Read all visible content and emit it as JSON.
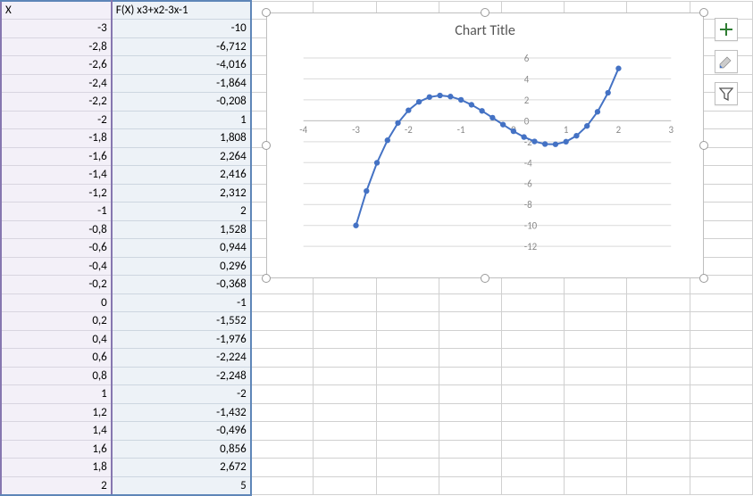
{
  "columns": {
    "a_header": "X",
    "b_header": "F(X) x3+x2-3x-1"
  },
  "rows": [
    {
      "x": "-3",
      "fx": "-10"
    },
    {
      "x": "-2,8",
      "fx": "-6,712"
    },
    {
      "x": "-2,6",
      "fx": "-4,016"
    },
    {
      "x": "-2,4",
      "fx": "-1,864"
    },
    {
      "x": "-2,2",
      "fx": "-0,208"
    },
    {
      "x": "-2",
      "fx": "1"
    },
    {
      "x": "-1,8",
      "fx": "1,808"
    },
    {
      "x": "-1,6",
      "fx": "2,264"
    },
    {
      "x": "-1,4",
      "fx": "2,416"
    },
    {
      "x": "-1,2",
      "fx": "2,312"
    },
    {
      "x": "-1",
      "fx": "2"
    },
    {
      "x": "-0,8",
      "fx": "1,528"
    },
    {
      "x": "-0,6",
      "fx": "0,944"
    },
    {
      "x": "-0,4",
      "fx": "0,296"
    },
    {
      "x": "-0,2",
      "fx": "-0,368"
    },
    {
      "x": "0",
      "fx": "-1"
    },
    {
      "x": "0,2",
      "fx": "-1,552"
    },
    {
      "x": "0,4",
      "fx": "-1,976"
    },
    {
      "x": "0,6",
      "fx": "-2,224"
    },
    {
      "x": "0,8",
      "fx": "-2,248"
    },
    {
      "x": "1",
      "fx": "-2"
    },
    {
      "x": "1,2",
      "fx": "-1,432"
    },
    {
      "x": "1,4",
      "fx": "-0,496"
    },
    {
      "x": "1,6",
      "fx": "0,856"
    },
    {
      "x": "1,8",
      "fx": "2,672"
    },
    {
      "x": "2",
      "fx": "5"
    }
  ],
  "chart": {
    "title": "Chart Title",
    "xticks": [
      "-4",
      "-3",
      "-2",
      "-1",
      "0",
      "1",
      "2",
      "3"
    ],
    "yticks": [
      "6",
      "4",
      "2",
      "0",
      "-2",
      "-4",
      "-6",
      "-8",
      "-10",
      "-12"
    ]
  },
  "chart_data": {
    "type": "line",
    "title": "Chart Title",
    "xlabel": "",
    "ylabel": "",
    "xlim": [
      -4,
      3
    ],
    "ylim": [
      -12,
      6
    ],
    "x": [
      -3,
      -2.8,
      -2.6,
      -2.4,
      -2.2,
      -2,
      -1.8,
      -1.6,
      -1.4,
      -1.2,
      -1,
      -0.8,
      -0.6,
      -0.4,
      -0.2,
      0,
      0.2,
      0.4,
      0.6,
      0.8,
      1,
      1.2,
      1.4,
      1.6,
      1.8,
      2
    ],
    "y": [
      -10,
      -6.712,
      -4.016,
      -1.864,
      -0.208,
      1,
      1.808,
      2.264,
      2.416,
      2.312,
      2,
      1.528,
      0.944,
      0.296,
      -0.368,
      -1,
      -1.552,
      -1.976,
      -2.224,
      -2.248,
      -2,
      -1.432,
      -0.496,
      0.856,
      2.672,
      5
    ],
    "series_name": "F(X) x3+x2-3x-1",
    "markers": true,
    "grid": true
  },
  "colors": {
    "line": "#4472c4",
    "grid": "#d9d9d9",
    "axis_text": "#888"
  }
}
